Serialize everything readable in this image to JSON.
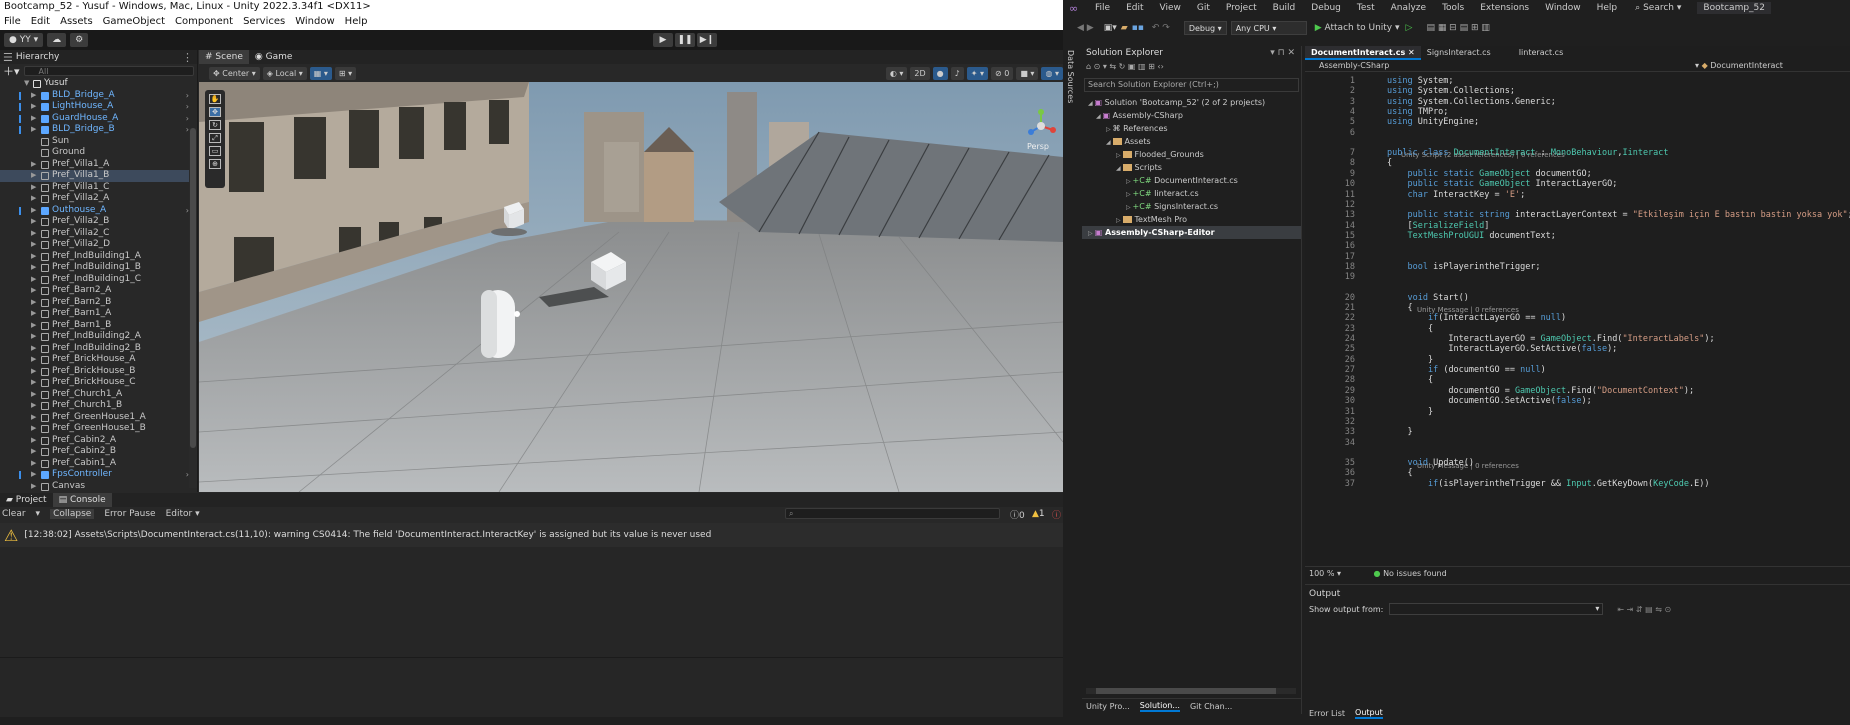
{
  "unity": {
    "title": "Bootcamp_52 - Yusuf - Windows, Mac, Linux - Unity 2022.3.34f1 <DX11>",
    "menu": [
      "File",
      "Edit",
      "Assets",
      "GameObject",
      "Component",
      "Services",
      "Window",
      "Help"
    ],
    "account": "YY",
    "hierarchy": {
      "tab": "Hierarchy",
      "search_placeholder": "All",
      "root": "Yusuf",
      "items": [
        {
          "label": "BLD_Bridge_A",
          "prefab": true
        },
        {
          "label": "LightHouse_A",
          "prefab": true
        },
        {
          "label": "GuardHouse_A",
          "prefab": true
        },
        {
          "label": "BLD_Bridge_B",
          "prefab": true
        },
        {
          "label": "Sun",
          "prefab": false
        },
        {
          "label": "Ground",
          "prefab": false
        },
        {
          "label": "Pref_Villa1_A",
          "prefab": false
        },
        {
          "label": "Pref_Villa1_B",
          "prefab": false
        },
        {
          "label": "Pref_Villa1_C",
          "prefab": false
        },
        {
          "label": "Pref_Villa2_A",
          "prefab": false
        },
        {
          "label": "Outhouse_A",
          "prefab": true
        },
        {
          "label": "Pref_Villa2_B",
          "prefab": false
        },
        {
          "label": "Pref_Villa2_C",
          "prefab": false
        },
        {
          "label": "Pref_Villa2_D",
          "prefab": false
        },
        {
          "label": "Pref_IndBuilding1_A",
          "prefab": false
        },
        {
          "label": "Pref_IndBuilding1_B",
          "prefab": false
        },
        {
          "label": "Pref_IndBuilding1_C",
          "prefab": false
        },
        {
          "label": "Pref_Barn2_A",
          "prefab": false
        },
        {
          "label": "Pref_Barn2_B",
          "prefab": false
        },
        {
          "label": "Pref_Barn1_A",
          "prefab": false
        },
        {
          "label": "Pref_Barn1_B",
          "prefab": false
        },
        {
          "label": "Pref_IndBuilding2_A",
          "prefab": false
        },
        {
          "label": "Pref_IndBuilding2_B",
          "prefab": false
        },
        {
          "label": "Pref_BrickHouse_A",
          "prefab": false
        },
        {
          "label": "Pref_BrickHouse_B",
          "prefab": false
        },
        {
          "label": "Pref_BrickHouse_C",
          "prefab": false
        },
        {
          "label": "Pref_Church1_A",
          "prefab": false
        },
        {
          "label": "Pref_Church1_B",
          "prefab": false
        },
        {
          "label": "Pref_GreenHouse1_A",
          "prefab": false
        },
        {
          "label": "Pref_GreenHouse1_B",
          "prefab": false
        },
        {
          "label": "Pref_Cabin2_A",
          "prefab": false
        },
        {
          "label": "Pref_Cabin2_B",
          "prefab": false
        },
        {
          "label": "Pref_Cabin1_A",
          "prefab": false
        },
        {
          "label": "FpsController",
          "prefab": true
        },
        {
          "label": "Canvas",
          "prefab": false
        }
      ]
    },
    "scene": {
      "tabs": [
        "Scene",
        "Game"
      ],
      "pivot": "Center",
      "space": "Local",
      "mode_2d": "2D",
      "persp": "Persp"
    },
    "console": {
      "tabs": [
        "Project",
        "Console"
      ],
      "buttons": [
        "Clear",
        "Collapse",
        "Error Pause",
        "Editor"
      ],
      "count_info": "0",
      "count_warn": "1",
      "message": "[12:38:02] Assets\\Scripts\\DocumentInteract.cs(11,10): warning CS0414: The field 'DocumentInteract.InteractKey' is assigned but its value is never used"
    }
  },
  "vs": {
    "menu": [
      "File",
      "Edit",
      "View",
      "Git",
      "Project",
      "Build",
      "Debug",
      "Test",
      "Analyze",
      "Tools",
      "Extensions",
      "Window",
      "Help"
    ],
    "search": "Search",
    "title": "Bootcamp_52",
    "config": "Debug",
    "platform": "Any CPU",
    "attach": "Attach to Unity",
    "data_sources": "Data Sources",
    "solution_explorer": {
      "title": "Solution Explorer",
      "search": "Search Solution Explorer (Ctrl+;)",
      "rows": [
        {
          "label": "Solution 'Bootcamp_52' (2 of 2 projects)",
          "indent": 6
        },
        {
          "label": "Assembly-CSharp",
          "indent": 14
        },
        {
          "label": "References",
          "indent": 24
        },
        {
          "label": "Assets",
          "indent": 24
        },
        {
          "label": "Flooded_Grounds",
          "indent": 34
        },
        {
          "label": "Scripts",
          "indent": 34
        },
        {
          "label": "DocumentInteract.cs",
          "indent": 44
        },
        {
          "label": "Iinteract.cs",
          "indent": 44
        },
        {
          "label": "SignsInteract.cs",
          "indent": 44
        },
        {
          "label": "TextMesh Pro",
          "indent": 34
        },
        {
          "label": "Assembly-CSharp-Editor",
          "indent": 6
        }
      ],
      "bottom_tabs": [
        "Unity Pro...",
        "Solution...",
        "Git Chan..."
      ]
    },
    "editor": {
      "tabs": [
        "DocumentInteract.cs",
        "SignsInteract.cs",
        "Iinteract.cs"
      ],
      "nav_left": "Assembly-CSharp",
      "nav_right": "DocumentInteract",
      "zoom": "100 %",
      "issues": "No issues found",
      "lens_unity_script": "Unity Script (2 asset references) | 0 references",
      "lens_msg_start": "Unity Message | 0 references",
      "lens_msg_update": "Unity Message | 0 references"
    },
    "output": {
      "title": "Output",
      "show_from": "Show output from:",
      "tabs": [
        "Error List",
        "Output"
      ]
    }
  },
  "code_lines": [
    {
      "n": "1",
      "t": "using System;"
    },
    {
      "n": "2",
      "t": "using System.Collections;"
    },
    {
      "n": "3",
      "t": "using System.Collections.Generic;"
    },
    {
      "n": "4",
      "t": "using TMPro;"
    },
    {
      "n": "5",
      "t": "using UnityEngine;"
    },
    {
      "n": "6",
      "t": ""
    },
    {
      "n": "7",
      "t": "public class DocumentInteract : MonoBehaviour,Iinteract"
    },
    {
      "n": "8",
      "t": "{"
    },
    {
      "n": "9",
      "t": "    public static GameObject documentGO;"
    },
    {
      "n": "10",
      "t": "    public static GameObject InteractLayerGO;"
    },
    {
      "n": "11",
      "t": "    char InteractKey = 'E';"
    },
    {
      "n": "12",
      "t": ""
    },
    {
      "n": "13",
      "t": "    public static string interactLayerContext = \"Etkileşim için E bastın bastin yoksa yok\";"
    },
    {
      "n": "14",
      "t": "    [SerializeField]"
    },
    {
      "n": "15",
      "t": "    TextMeshProUGUI documentText;"
    },
    {
      "n": "16",
      "t": ""
    },
    {
      "n": "17",
      "t": ""
    },
    {
      "n": "18",
      "t": "    bool isPlayerintheTrigger;"
    },
    {
      "n": "19",
      "t": ""
    },
    {
      "n": "20",
      "t": "    void Start()"
    },
    {
      "n": "21",
      "t": "    {"
    },
    {
      "n": "22",
      "t": "        if(InteractLayerGO == null)"
    },
    {
      "n": "23",
      "t": "        {"
    },
    {
      "n": "24",
      "t": "            InteractLayerGO = GameObject.Find(\"InteractLabels\");"
    },
    {
      "n": "25",
      "t": "            InteractLayerGO.SetActive(false);"
    },
    {
      "n": "26",
      "t": "        }"
    },
    {
      "n": "27",
      "t": "        if (documentGO == null)"
    },
    {
      "n": "28",
      "t": "        {"
    },
    {
      "n": "29",
      "t": "            documentGO = GameObject.Find(\"DocumentContext\");"
    },
    {
      "n": "30",
      "t": "            documentGO.SetActive(false);"
    },
    {
      "n": "31",
      "t": "        }"
    },
    {
      "n": "32",
      "t": ""
    },
    {
      "n": "33",
      "t": "    }"
    },
    {
      "n": "34",
      "t": ""
    },
    {
      "n": "35",
      "t": "    void Update()"
    },
    {
      "n": "36",
      "t": "    {"
    },
    {
      "n": "37",
      "t": "        if(isPlayerintheTrigger && Input.GetKeyDown(KeyCode.E))"
    }
  ]
}
